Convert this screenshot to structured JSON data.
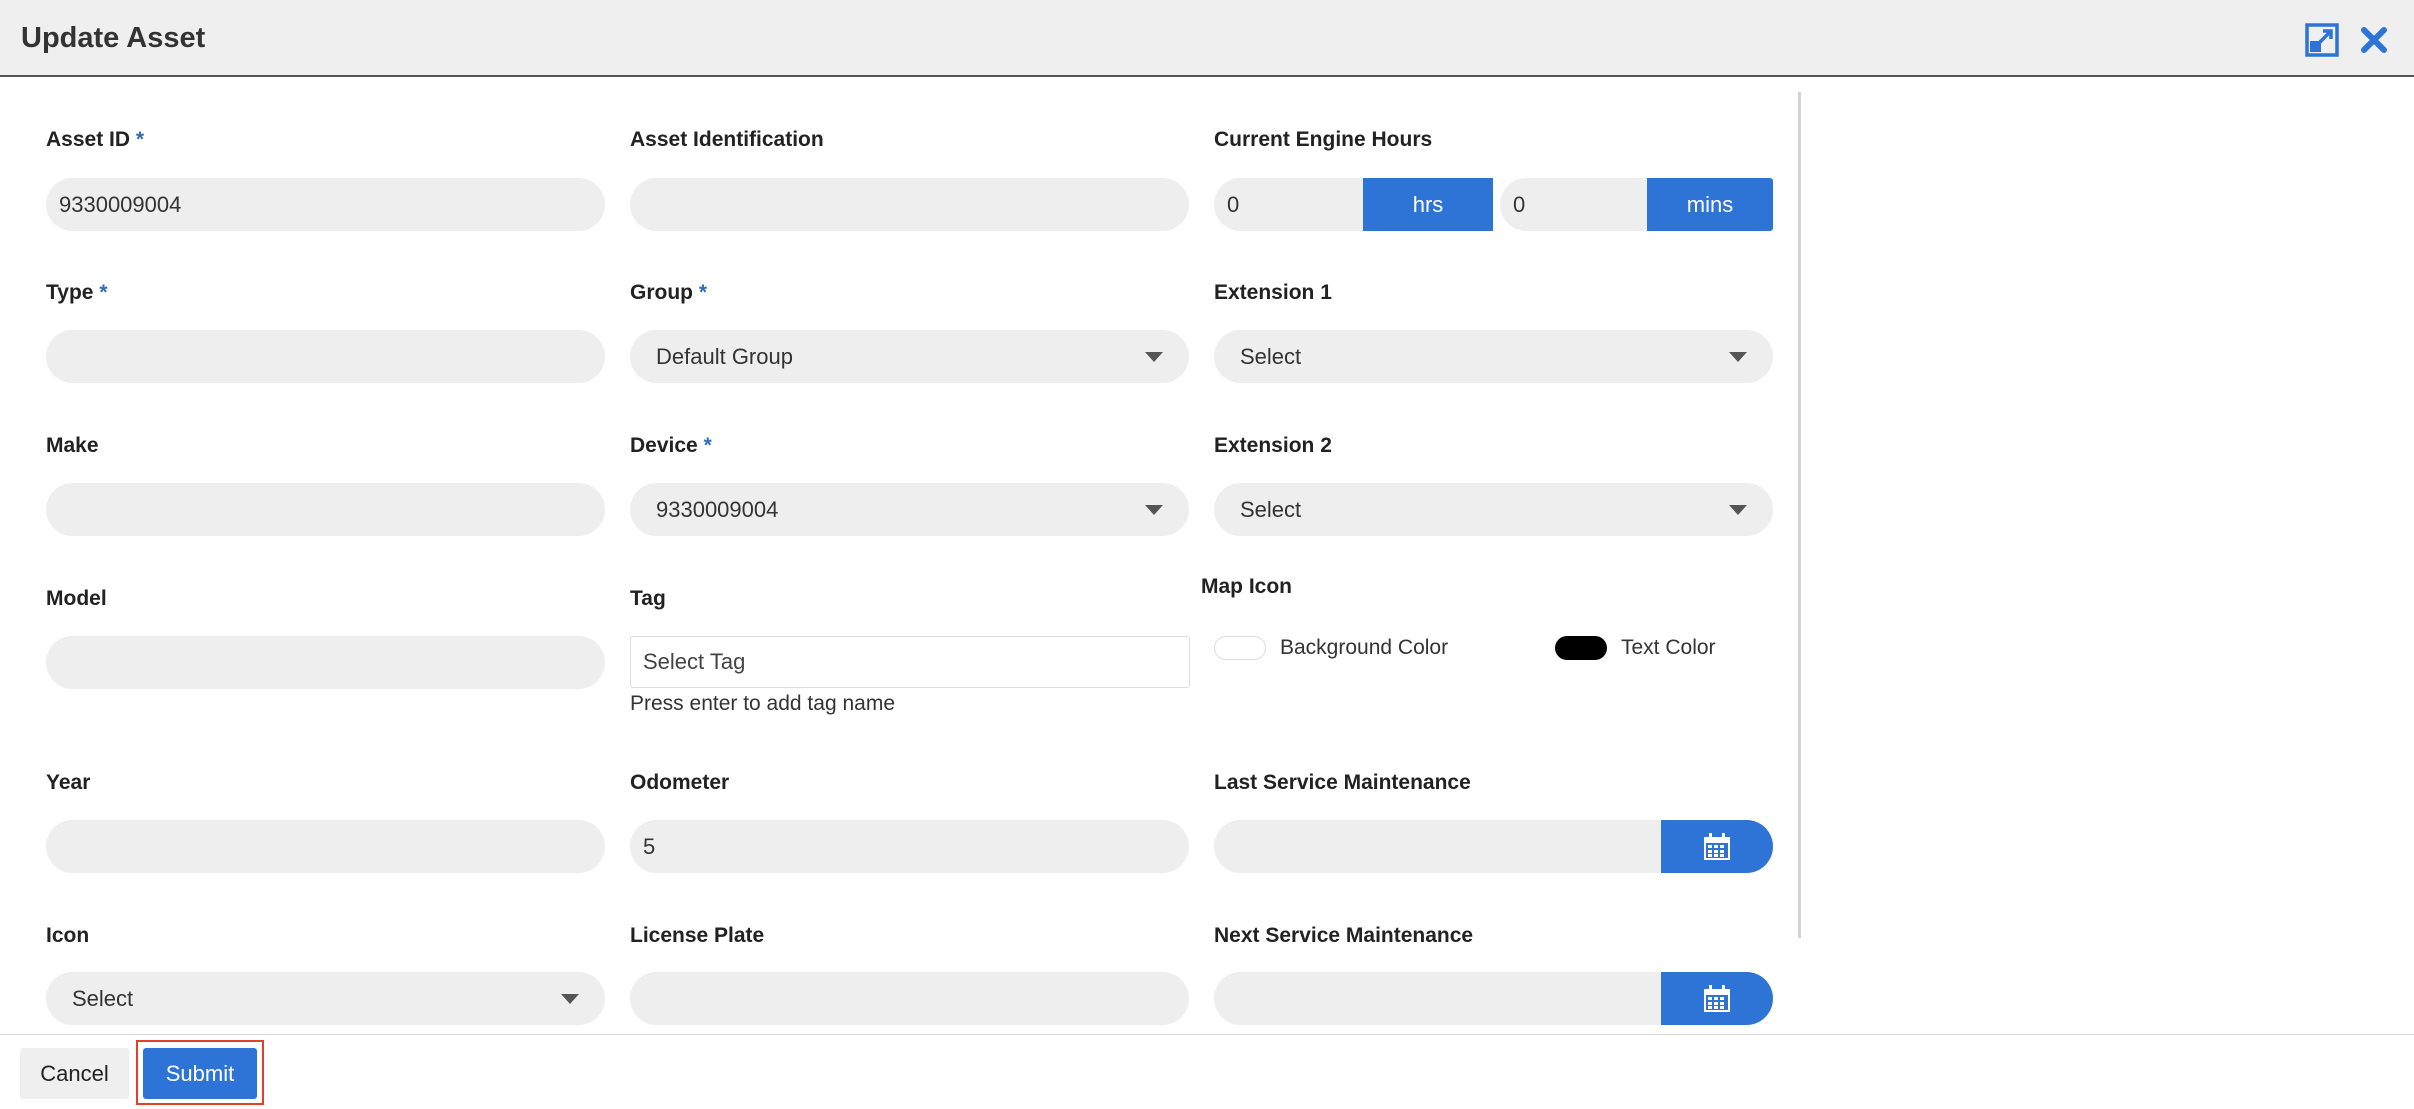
{
  "header": {
    "title": "Update Asset"
  },
  "form": {
    "asset_id": {
      "label": "Asset ID",
      "required": "*",
      "value": "9330009004"
    },
    "asset_identification": {
      "label": "Asset Identification",
      "value": ""
    },
    "engine_hours": {
      "label": "Current Engine Hours",
      "hours_value": "0",
      "hours_unit": "hrs",
      "mins_value": "0",
      "mins_unit": "mins"
    },
    "type": {
      "label": "Type",
      "required": "*",
      "value": ""
    },
    "group": {
      "label": "Group",
      "required": "*",
      "value": "Default Group"
    },
    "extension_1": {
      "label": "Extension 1",
      "value": "Select"
    },
    "make": {
      "label": "Make",
      "value": ""
    },
    "device": {
      "label": "Device",
      "required": "*",
      "value": "9330009004"
    },
    "extension_2": {
      "label": "Extension 2",
      "value": "Select"
    },
    "model": {
      "label": "Model",
      "value": ""
    },
    "tag": {
      "label": "Tag",
      "placeholder": "Select Tag",
      "hint": "Press enter to add tag name"
    },
    "map_icon": {
      "label": "Map Icon",
      "background_label": "Background Color",
      "background_color": "#ffffff",
      "text_label": "Text Color",
      "text_color": "#000000"
    },
    "year": {
      "label": "Year",
      "value": ""
    },
    "odometer": {
      "label": "Odometer",
      "value": "5"
    },
    "last_service": {
      "label": "Last Service Maintenance",
      "value": ""
    },
    "icon": {
      "label": "Icon",
      "value": "Select"
    },
    "license_plate": {
      "label": "License Plate",
      "value": ""
    },
    "next_service": {
      "label": "Next Service Maintenance",
      "value": ""
    }
  },
  "footer": {
    "cancel_label": "Cancel",
    "submit_label": "Submit"
  },
  "colors": {
    "accent": "#2d74d6",
    "field_bg": "#eeeeee",
    "required_star": "#2f6eb5",
    "highlight_frame": "#e0412a"
  },
  "icons": {
    "expand": "expand-icon",
    "close": "close-icon",
    "calendar": "calendar-icon",
    "dropdown": "chevron-down-icon"
  }
}
